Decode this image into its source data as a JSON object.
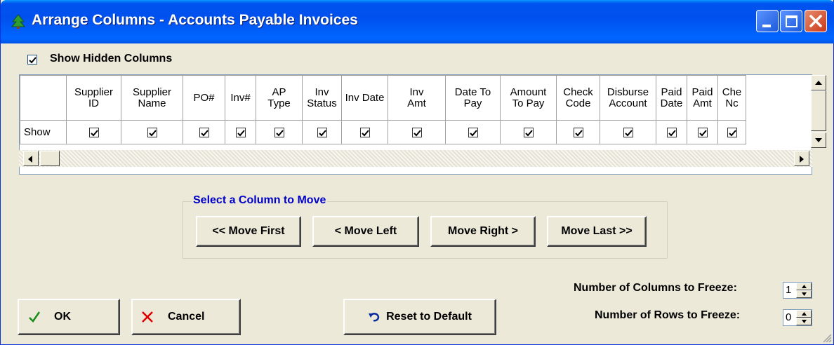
{
  "window": {
    "title": "Arrange Columns - Accounts Payable Invoices"
  },
  "show_hidden": {
    "label": "Show Hidden Columns",
    "checked": true
  },
  "grid": {
    "row_label": "Show",
    "columns": [
      {
        "line1": "Supplier",
        "line2": "ID"
      },
      {
        "line1": "Supplier",
        "line2": "Name"
      },
      {
        "line1": "PO#",
        "line2": ""
      },
      {
        "line1": "Inv#",
        "line2": ""
      },
      {
        "line1": "AP",
        "line2": "Type"
      },
      {
        "line1": "Inv",
        "line2": "Status"
      },
      {
        "line1": "Inv Date",
        "line2": ""
      },
      {
        "line1": "Inv",
        "line2": "Amt"
      },
      {
        "line1": "Date To",
        "line2": "Pay"
      },
      {
        "line1": "Amount",
        "line2": "To Pay"
      },
      {
        "line1": "Check",
        "line2": "Code"
      },
      {
        "line1": "Disburse",
        "line2": "Account"
      },
      {
        "line1": "Paid",
        "line2": "Date"
      },
      {
        "line1": "Paid",
        "line2": "Amt"
      },
      {
        "line1": "Che",
        "line2": "Nc"
      }
    ]
  },
  "move_group": {
    "legend": "Select a Column to Move",
    "move_first": "<< Move First",
    "move_left": "< Move Left",
    "move_right": "Move Right >",
    "move_last": "Move Last >>"
  },
  "freeze": {
    "cols_label": "Number of Columns to Freeze:",
    "cols_value": "1",
    "rows_label": "Number of Rows to Freeze:",
    "rows_value": "0"
  },
  "buttons": {
    "ok": "OK",
    "cancel": "Cancel",
    "reset": "Reset to Default"
  },
  "colors": {
    "titlebar": "#0054e3",
    "legend": "#0000c8",
    "ok_icon": "#1a8c1a",
    "cancel_icon": "#e00000"
  }
}
